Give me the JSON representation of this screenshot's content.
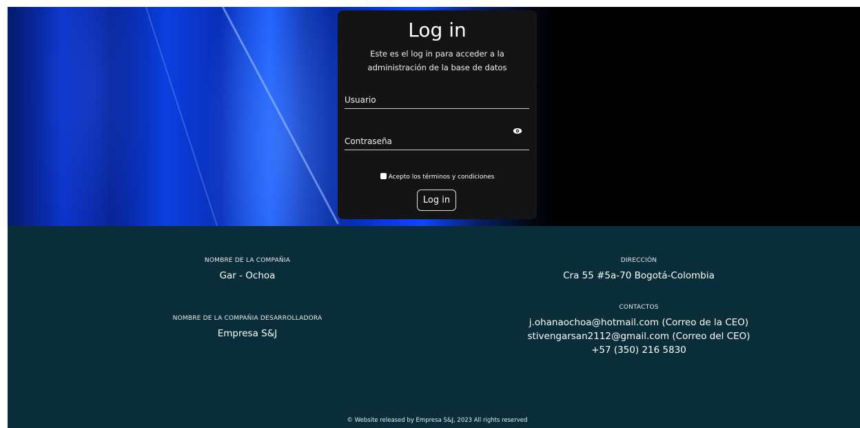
{
  "login": {
    "title": "Log in",
    "subtitle": "Este es el log in para acceder a la administración de la base de datos",
    "username_placeholder": "Usuario",
    "password_placeholder": "Contraseña",
    "terms_label": "Acepto los  términos y condiciones",
    "submit_label": "Log in"
  },
  "footer": {
    "company_label": "NOMBRE DE LA COMPAÑIA",
    "company_value": "Gar - Ochoa",
    "developer_label": "NOMBRE DE LA COMPAÑIA DESARROLLADORA",
    "developer_value": "Empresa S&J",
    "address_label": "DIRECCIÓN",
    "address_value": "Cra 55 #5a-70 Bogotá-Colombia",
    "contacts_label": "CONTACTOS",
    "contacts": [
      "j.ohanaochoa@hotmail.com (Correo de la CEO)",
      "stivengarsan2112@gmail.com (Correo del CEO)",
      "+57 (350) 216 5830"
    ],
    "copyright": "© Website released by Empresa S&J, 2023 All rights reserved"
  },
  "colors": {
    "card_bg": "#141414",
    "footer_bg": "#0a2d3a",
    "hero_blue": "#0b3fe0"
  },
  "icons": {
    "password_toggle": "eye-icon"
  }
}
